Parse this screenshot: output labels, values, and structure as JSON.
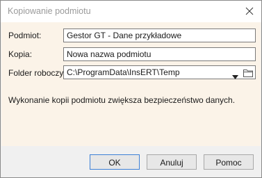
{
  "window": {
    "title": "Kopiowanie podmiotu",
    "close_icon": "close-icon"
  },
  "form": {
    "podmiot": {
      "label": "Podmiot:",
      "value": "Gestor GT - Dane przykładowe"
    },
    "kopia": {
      "label": "Kopia:",
      "value": "Nowa nazwa podmiotu"
    },
    "folder": {
      "label": "Folder roboczy:",
      "value": "C:\\ProgramData\\InsERT\\Temp",
      "dropdown_icon": "chevron-down-icon",
      "browse_icon": "folder-icon"
    }
  },
  "info_text": "Wykonanie kopii podmiotu zwiększa bezpieczeństwo danych.",
  "buttons": {
    "ok": "OK",
    "cancel": "Anuluj",
    "help": "Pomoc"
  },
  "colors": {
    "content_bg": "#fbf3e8",
    "focus_border": "#3c7fd6"
  }
}
